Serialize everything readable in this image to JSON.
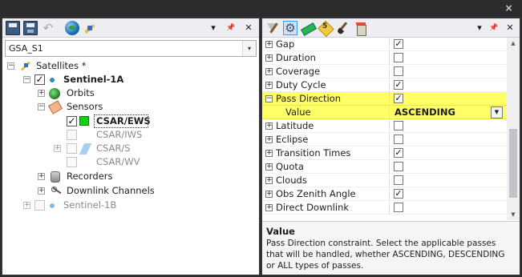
{
  "window": {
    "close_glyph": "×"
  },
  "left_pane": {
    "toolbar": {
      "pin": "📌",
      "dropdown": "▾",
      "close": "✕"
    },
    "selector": {
      "value": "GSA_S1",
      "arrow": "▾"
    },
    "tree": {
      "satellites": {
        "label": "Satellites *",
        "expander": "−"
      },
      "sentinel_1a": {
        "label": "Sentinel-1A",
        "expander": "−",
        "checked": "✓"
      },
      "orbits": {
        "label": "Orbits",
        "expander": "+"
      },
      "sensors": {
        "label": "Sensors",
        "expander": "−"
      },
      "sensor_items": [
        {
          "label": "CSAR/EWS",
          "checked": "✓",
          "bold": true
        },
        {
          "label": "CSAR/IWS",
          "checked": "",
          "dim": true
        },
        {
          "label": "CSAR/S",
          "checked": "",
          "dim": true,
          "expander": "+"
        },
        {
          "label": "CSAR/WV",
          "checked": "",
          "dim": true
        }
      ],
      "recorders": {
        "label": "Recorders",
        "expander": "+"
      },
      "downlink_channels": {
        "label": "Downlink Channels",
        "expander": "+"
      },
      "sentinel_1b": {
        "label": "Sentinel-1B",
        "expander": "+"
      }
    }
  },
  "right_pane": {
    "toolbar": {
      "dropdown": "▾",
      "pin": "📌",
      "close": "✕"
    },
    "properties": [
      {
        "name": "Gap",
        "checked": "✓",
        "expander": "+"
      },
      {
        "name": "Duration",
        "checked": "",
        "expander": "+"
      },
      {
        "name": "Coverage",
        "checked": "",
        "expander": "+"
      },
      {
        "name": "Duty Cycle",
        "checked": "✓",
        "expander": "+"
      },
      {
        "name": "Pass Direction",
        "checked": "✓",
        "expander": "−"
      },
      {
        "name": "Value",
        "value": "ASCENDING"
      },
      {
        "name": "Latitude",
        "checked": "",
        "expander": "+"
      },
      {
        "name": "Eclipse",
        "checked": "",
        "expander": "+"
      },
      {
        "name": "Transition Times",
        "checked": "✓",
        "expander": "+"
      },
      {
        "name": "Quota",
        "checked": "",
        "expander": "+"
      },
      {
        "name": "Clouds",
        "checked": "",
        "expander": "+"
      },
      {
        "name": "Obs Zenith Angle",
        "checked": "✓",
        "expander": "+"
      },
      {
        "name": "Direct Downlink",
        "checked": "",
        "expander": "+"
      }
    ],
    "value_dropdown_arrow": "▼",
    "scrollbar": {
      "up": "▲",
      "down": "▼"
    },
    "description": {
      "title": "Value",
      "text": "Pass Direction constraint. Select the applicable passes that will be handled, whether ASCENDING, DESCENDING or ALL types of passes."
    }
  },
  "colors": {
    "highlight": "#ffff66",
    "selected_sensor": "#11d311",
    "accent": "#3399ff"
  }
}
